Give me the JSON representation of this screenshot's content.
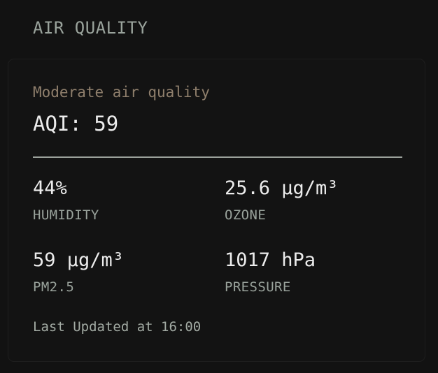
{
  "section": {
    "title": "AIR QUALITY"
  },
  "card": {
    "quality_label": "Moderate air quality",
    "aqi": "AQI: 59",
    "metrics": [
      {
        "value": "44%",
        "label": "HUMIDITY"
      },
      {
        "value": "25.6 μg/m³",
        "label": "OZONE"
      },
      {
        "value": "59 μg/m³",
        "label": "PM2.5"
      },
      {
        "value": "1017 hPa",
        "label": "PRESSURE"
      }
    ],
    "last_updated": "Last Updated at 16:00"
  },
  "colors": {
    "background": "#121212",
    "card": "#131313",
    "quality_accent": "#8f7f6c",
    "muted_text": "#9aa39c",
    "primary_text": "#ececec"
  }
}
